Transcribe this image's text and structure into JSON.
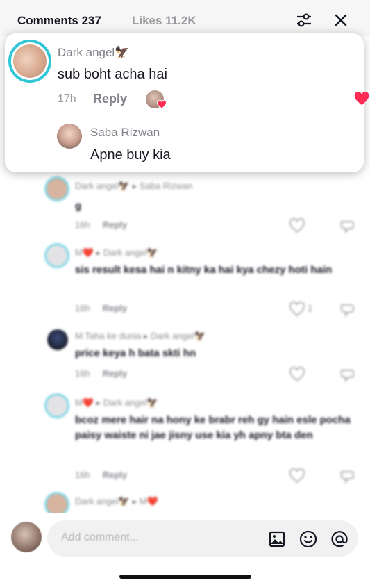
{
  "header": {
    "comments_tab": "Comments 237",
    "likes_tab": "Likes 11.2K",
    "filter_icon": "sliders-icon",
    "close_icon": "close-icon"
  },
  "pinned_comment": {
    "author": "Dark angel🦅",
    "text": "sub boht acha hai",
    "time": "17h",
    "reply_label": "Reply",
    "creator_liked": true,
    "liked": true,
    "reply": {
      "author": "Saba Rizwan",
      "text": "Apne buy kia"
    }
  },
  "comments": [
    {
      "author": "Dark angel🦅 ▸ Saba Rizwan",
      "text": "g",
      "time": "16h",
      "reply_label": "Reply",
      "likes": ""
    },
    {
      "author": "M❤️ ▸ Dark angel🦅",
      "text": "sis result kesa hai n kitny ka hai kya chezy hoti hain",
      "time": "16h",
      "reply_label": "Reply",
      "likes": "1"
    },
    {
      "author": "M.Taha ke dunia ▸ Dark angel🦅",
      "text": "price keya h bata skti hn",
      "time": "16h",
      "reply_label": "Reply",
      "likes": ""
    },
    {
      "author": "M❤️ ▸ Dark angel🦅",
      "text": "bcoz mere hair na hony ke brabr reh gy hain esle pocha paisy waiste ni jae jisny use kia yh apny bta den",
      "time": "16h",
      "reply_label": "Reply",
      "likes": ""
    },
    {
      "author": "Dark angel🦅 ▸ M❤️",
      "text": "",
      "time": "",
      "reply_label": "",
      "likes": ""
    }
  ],
  "composer": {
    "placeholder": "Add comment...",
    "icons": [
      "image-icon",
      "emoji-icon",
      "mention-icon"
    ]
  },
  "colors": {
    "accent_ring": "#2fc6d6",
    "like_red": "#fe2c55",
    "text_primary": "#161823",
    "text_secondary": "#8a8b91"
  }
}
